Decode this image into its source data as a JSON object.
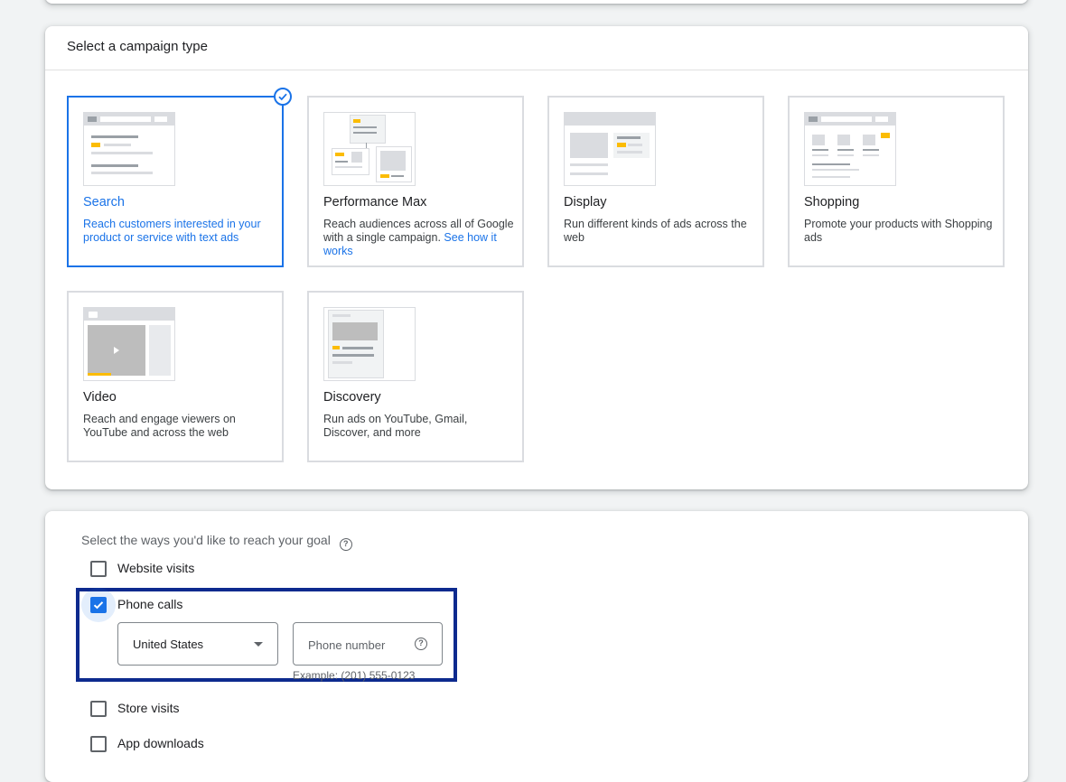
{
  "campaign_type_card": {
    "title": "Select a campaign type",
    "tiles": [
      {
        "name": "Search",
        "description": "Reach customers interested in your product or service with text ads",
        "selected": true
      },
      {
        "name": "Performance Max",
        "description": "Reach audiences across all of Google with a single campaign.",
        "link": "See how it works",
        "selected": false
      },
      {
        "name": "Display",
        "description": "Run different kinds of ads across the web",
        "selected": false
      },
      {
        "name": "Shopping",
        "description": "Promote your products with Shopping ads",
        "selected": false
      },
      {
        "name": "Video",
        "description": "Reach and engage viewers on YouTube and across the web",
        "selected": false
      },
      {
        "name": "Discovery",
        "description": "Run ads on YouTube, Gmail, Discover, and more",
        "selected": false
      }
    ]
  },
  "goal_card": {
    "label": "Select the ways you'd like to reach your goal",
    "options": [
      {
        "label": "Website visits",
        "checked": false
      },
      {
        "label": "Phone calls",
        "checked": true
      },
      {
        "label": "Store visits",
        "checked": false
      },
      {
        "label": "App downloads",
        "checked": false
      }
    ],
    "phone": {
      "country": "United States",
      "placeholder": "Phone number",
      "hint": "Example: (201) 555-0123"
    }
  },
  "colors": {
    "accent": "#1a73e8",
    "highlight_border": "#0d2a8e",
    "thumb_accent": "#fbbc04",
    "thumb_gray": "#dadce0"
  }
}
